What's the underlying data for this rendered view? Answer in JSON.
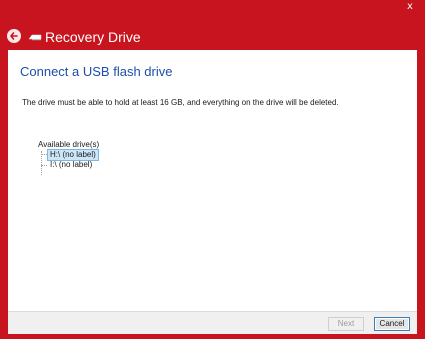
{
  "window": {
    "title": "Recovery Drive",
    "close_glyph": "x",
    "accent_color": "#c8141e"
  },
  "page": {
    "heading": "Connect a USB flash drive",
    "description": "The drive must be able to hold at least 16 GB, and everything on the drive will be deleted.",
    "list_label": "Available drive(s)",
    "drives": [
      {
        "label": "H:\\ (no label)",
        "selected": true
      },
      {
        "label": "I:\\ (no label)",
        "selected": false
      }
    ]
  },
  "footer": {
    "next_label": "Next",
    "cancel_label": "Cancel"
  },
  "icons": {
    "back": "back-arrow-icon",
    "drive": "usb-drive-icon",
    "close": "close-icon"
  }
}
